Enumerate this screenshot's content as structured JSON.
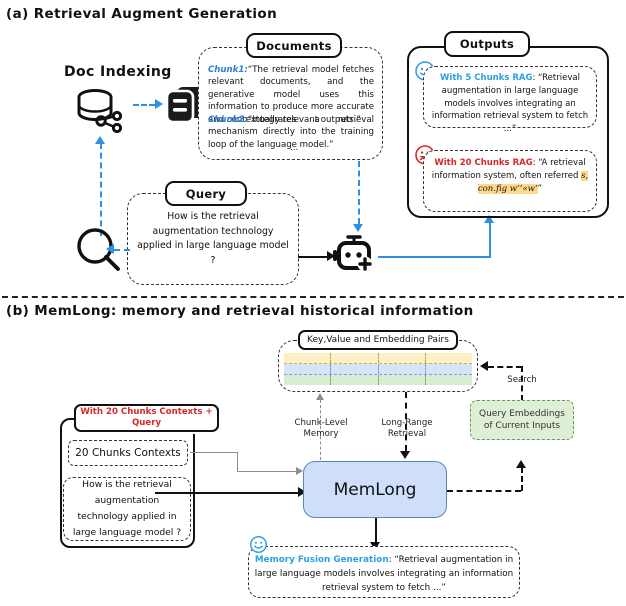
{
  "sections": {
    "a": {
      "title": "(a) Retrieval Augment Generation"
    },
    "b": {
      "title": "(b) MemLong: memory and retrieval historical information"
    }
  },
  "panel_a": {
    "doc_indexing_label": "Doc Indexing",
    "icons": {
      "database": "database-icon",
      "documents": "documents-stack-icon",
      "search": "magnifier-icon",
      "bot": "robot-plus-icon"
    },
    "documents": {
      "header": "Documents",
      "chunk1_key": "Chunk1:",
      "chunk1_text": "“The retrieval model fetches relevant documents, and the generative model uses this information to produce more accurate and contextually relevant outputs.”",
      "chunk2_key": "Chunk2:",
      "chunk2_text": "“Integrates a retrieval mechanism directly into the training loop of the language model.”",
      "ellipsis": "..."
    },
    "query": {
      "header": "Query",
      "text": "How is the retrieval augmentation technology applied in large language model ?"
    },
    "outputs": {
      "header": "Outputs",
      "good": {
        "face": "smiley-face-icon",
        "key": "With 5 Chunks RAG",
        "text": ": “Retrieval augmentation in large language models involves integrating an information retrieval system to fetch ...”"
      },
      "bad": {
        "face": "sad-face-icon",
        "key": "With 20 Chunks RAG",
        "text_before": ": “A retrieval information system, often referred ",
        "garbled": "s, con.fig w’’«w’",
        "text_after": "”"
      }
    }
  },
  "panel_b": {
    "memory_header": "Key,Value and Embedding Pairs",
    "memory_rows": [
      {
        "name": "key-row",
        "color": "#fdf0c7",
        "cells": 4
      },
      {
        "name": "value-row",
        "color": "#d6e4f7",
        "cells": 4
      },
      {
        "name": "embedding-row",
        "color": "#d9ecd0",
        "cells": 4
      }
    ],
    "prompt_banner": "With 20 Chunks Contexts + Query",
    "chunks_box": "20 Chunks Contexts",
    "query_box": "How is the retrieval augmentation technology applied in large language model ?",
    "core_label": "MemLong",
    "edge_labels": {
      "chunk_level_memory": "Chunk-Level\nMemory",
      "long_range_retrieval": "Long-Range\nRetrieval",
      "search": "Search"
    },
    "query_embeddings": "Query Embeddings\nof Current Inputs",
    "output": {
      "face": "smiley-face-icon",
      "key": "Memory Fusion Generation",
      "text": ": “Retrieval augmentation in large language models involves integrating an information retrieval system to fetch ...”"
    }
  },
  "colors": {
    "accent_blue": "#2f8fe0",
    "chunk_blue": "#2f7ddb",
    "error_red": "#d6282b",
    "highlight": "#ffd98a",
    "memlong_fill": "#cfdffa",
    "embedding_fill": "#dfeed7"
  }
}
